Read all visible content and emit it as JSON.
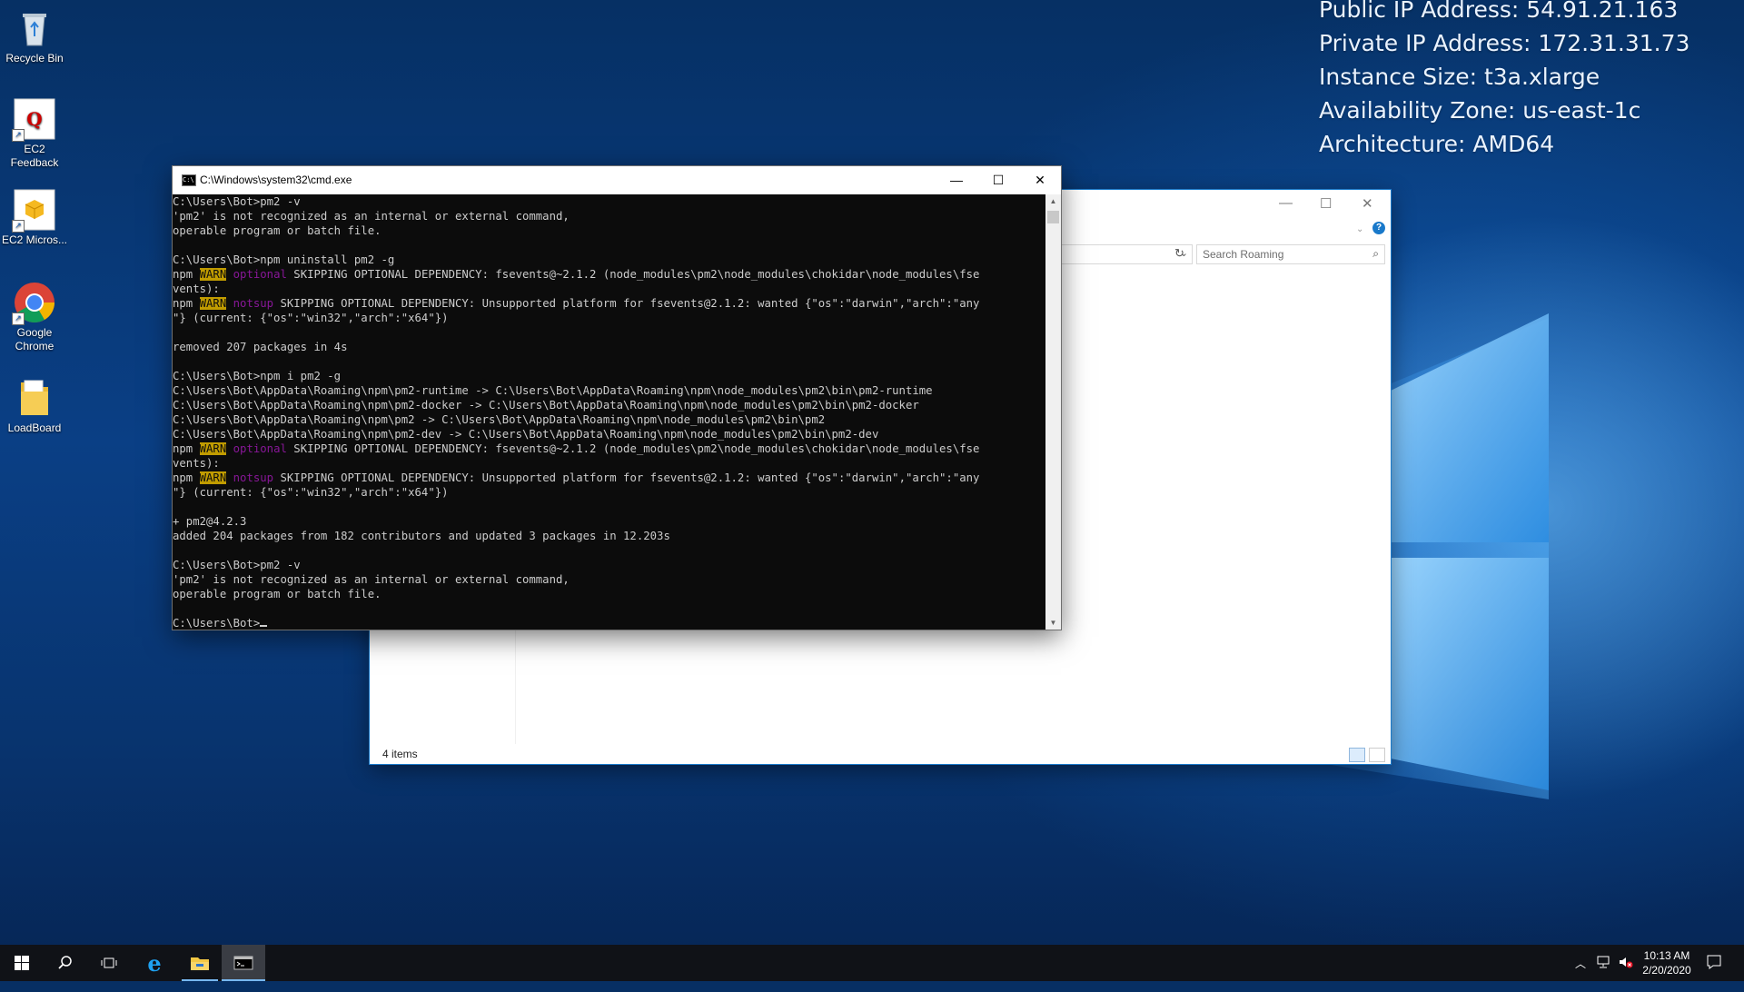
{
  "desktop": {
    "info_lines": [
      "Public IP Address: 54.91.21.163",
      "Private IP Address: 172.31.31.73",
      "Instance Size: t3a.xlarge",
      "Availability Zone: us-east-1c",
      "Architecture: AMD64"
    ],
    "icons": [
      {
        "label": "Recycle Bin",
        "icon": "recycle-bin-icon"
      },
      {
        "label": "EC2 Feedback",
        "icon": "ec2-feedback-icon"
      },
      {
        "label": "EC2 Micros...",
        "icon": "ec2-microsoft-icon"
      },
      {
        "label": "Google Chrome",
        "icon": "chrome-icon"
      },
      {
        "label": "LoadBoard",
        "icon": "folder-icon"
      }
    ]
  },
  "explorer": {
    "search_placeholder": "Search Roaming",
    "status": "4 items"
  },
  "cmd": {
    "title": "C:\\Windows\\system32\\cmd.exe",
    "lines": [
      "C:\\Users\\Bot>pm2 -v",
      "'pm2' is not recognized as an internal or external command,",
      "operable program or batch file.",
      "",
      "C:\\Users\\Bot>npm uninstall pm2 -g",
      "__W1__",
      "vents):",
      "__W2__",
      "\"} (current: {\"os\":\"win32\",\"arch\":\"x64\"})",
      "",
      "removed 207 packages in 4s",
      "",
      "C:\\Users\\Bot>npm i pm2 -g",
      "C:\\Users\\Bot\\AppData\\Roaming\\npm\\pm2-runtime -> C:\\Users\\Bot\\AppData\\Roaming\\npm\\node_modules\\pm2\\bin\\pm2-runtime",
      "C:\\Users\\Bot\\AppData\\Roaming\\npm\\pm2-docker -> C:\\Users\\Bot\\AppData\\Roaming\\npm\\node_modules\\pm2\\bin\\pm2-docker",
      "C:\\Users\\Bot\\AppData\\Roaming\\npm\\pm2 -> C:\\Users\\Bot\\AppData\\Roaming\\npm\\node_modules\\pm2\\bin\\pm2",
      "C:\\Users\\Bot\\AppData\\Roaming\\npm\\pm2-dev -> C:\\Users\\Bot\\AppData\\Roaming\\npm\\node_modules\\pm2\\bin\\pm2-dev",
      "__W1__",
      "vents):",
      "__W2__",
      "\"} (current: {\"os\":\"win32\",\"arch\":\"x64\"})",
      "",
      "+ pm2@4.2.3",
      "added 204 packages from 182 contributors and updated 3 packages in 12.203s",
      "",
      "C:\\Users\\Bot>pm2 -v",
      "'pm2' is not recognized as an internal or external command,",
      "operable program or batch file.",
      "",
      "C:\\Users\\Bot>"
    ],
    "warn_prefix": "npm ",
    "warn_tag": "WARN",
    "warn1_level": "optional",
    "warn1_text": " SKIPPING OPTIONAL DEPENDENCY: fsevents@~2.1.2 (node_modules\\pm2\\node_modules\\chokidar\\node_modules\\fse",
    "warn2_level": "notsup",
    "warn2_text": " SKIPPING OPTIONAL DEPENDENCY: Unsupported platform for fsevents@2.1.2: wanted {\"os\":\"darwin\",\"arch\":\"any"
  },
  "taskbar": {
    "time": "10:13 AM",
    "date": "2/20/2020"
  },
  "colors": {
    "warn_bg": "#c19c00",
    "level_fg": "#881798",
    "terminal_bg": "#0c0c0c",
    "terminal_fg": "#cccccc"
  }
}
